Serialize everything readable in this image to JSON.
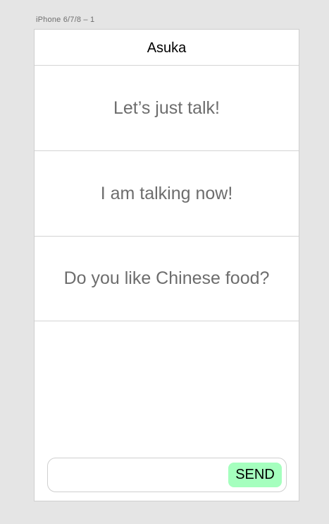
{
  "artboard": {
    "label": "iPhone 6/7/8 – 1"
  },
  "nav": {
    "title": "Asuka"
  },
  "messages": [
    {
      "text": "Let’s just talk!"
    },
    {
      "text": "I am talking now!"
    },
    {
      "text": "Do you like Chinese food?"
    }
  ],
  "composer": {
    "input_value": "",
    "input_placeholder": "",
    "send_label": "SEND"
  },
  "colors": {
    "send_button_bg": "#a5ffbe",
    "message_text": "#6d6d6d",
    "canvas_bg": "#e5e5e5"
  }
}
